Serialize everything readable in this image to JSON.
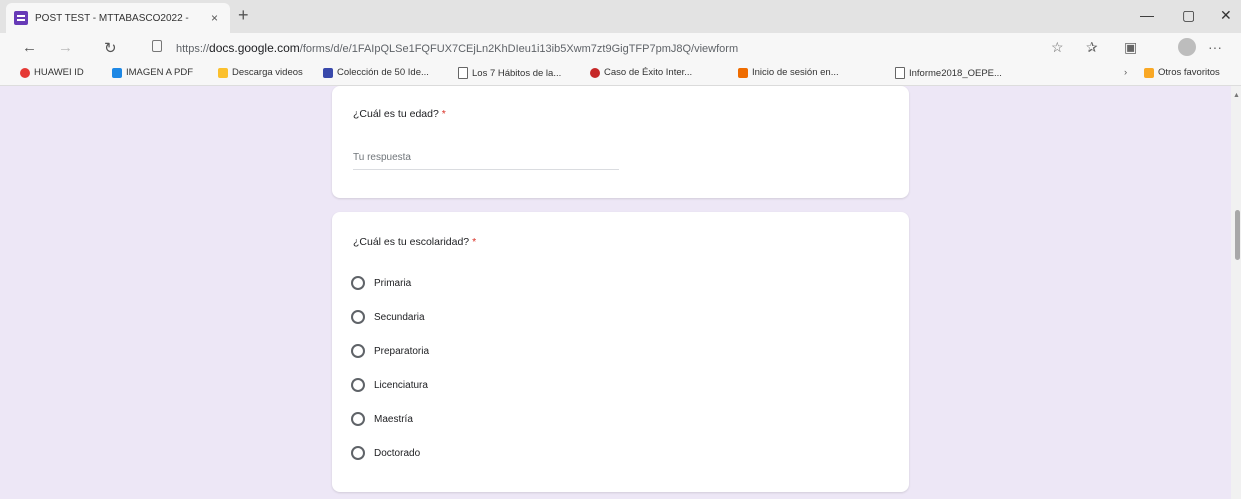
{
  "browser": {
    "tab_title": "POST TEST - MTTABASCO2022 - ",
    "tab_close": "×",
    "new_tab": "+",
    "minimize": "—",
    "restore": "▢",
    "close": "✕",
    "back": "←",
    "forward": "→",
    "refresh": "↻",
    "url_prefix": "https://",
    "url_domain": "docs.google.com",
    "url_path": "/forms/d/e/1FAIpQLSe1FQFUX7CEjLn2KhDIeu1i13ib5Xwm7zt9GigTFP7pmJ8Q/viewform",
    "more": "···"
  },
  "bookmarks": [
    {
      "label": "HUAWEI ID",
      "icon": "huawei-icon",
      "color": "#e53935"
    },
    {
      "label": "IMAGEN A PDF",
      "icon": "image-pdf-icon",
      "color": "#1e88e5"
    },
    {
      "label": "Descarga videos",
      "icon": "download-icon",
      "color": "#fbc02d"
    },
    {
      "label": "Colección de 50 Ide...",
      "icon": "collection-icon",
      "color": "#3949ab"
    },
    {
      "label": "Los 7 Hábitos de la...",
      "icon": "doc-icon",
      "color": "#ffffff"
    },
    {
      "label": "Caso de Éxito Inter...",
      "icon": "globe-icon",
      "color": "#c62828"
    },
    {
      "label": "Inicio de sesión en...",
      "icon": "login-icon",
      "color": "#ef6c00"
    },
    {
      "label": "Informe2018_OEPE...",
      "icon": "doc-icon",
      "color": "#ffffff"
    },
    {
      "label": "Otros favoritos",
      "icon": "folder-icon",
      "color": "#f9a825"
    }
  ],
  "form": {
    "q_age": {
      "title": "¿Cuál es tu edad?",
      "required_mark": "*",
      "placeholder": "Tu respuesta"
    },
    "q_school": {
      "title": "¿Cuál es tu escolaridad?",
      "required_mark": "*",
      "options": [
        "Primaria",
        "Secundaria",
        "Preparatoria",
        "Licenciatura",
        "Maestría",
        "Doctorado"
      ]
    }
  }
}
